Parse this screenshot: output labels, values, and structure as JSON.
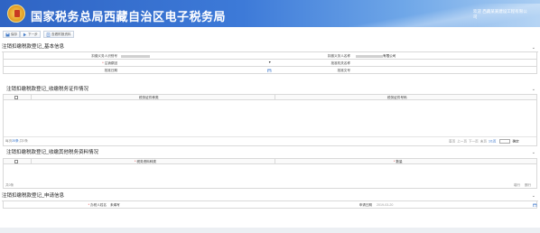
{
  "header": {
    "title": "国家税务总局西藏自治区电子税务局",
    "user_line1": "欢迎 西藏某某建设工程有限公",
    "user_line2": "司"
  },
  "toolbar": {
    "save": "保存",
    "next": "下一步",
    "view_materials": "查看附报资料"
  },
  "basic": {
    "title": "注销扣缴税款登记_基本信息",
    "taxpayer_id_label": "扣缴义务人识别号",
    "taxpayer_name_label": "扣缴义务人名称",
    "taxpayer_name_value": "有限公司",
    "reason_label": "注销原因",
    "org_label": "批准机关名称",
    "date_label": "批准日期",
    "doc_label": "批准文号"
  },
  "certs": {
    "title": "注销扣缴税款登记_收缴税务证件情况",
    "col_type": "税务证件种类",
    "col_no": "税务证件号码",
    "summary_prefix": "每页",
    "summary_count": "20条",
    "summary_suffix": ",共0条",
    "pager_first": "首页",
    "pager_prev": "上一页",
    "pager_next": "下一页",
    "pager_end": "末页",
    "pager_pages": "1/1页",
    "pager_go": "确定"
  },
  "others": {
    "title": "注销扣缴税款登记_收缴其他税务资料情况",
    "col_type": "税务资料种类",
    "col_count": "数量",
    "summary": "共0条",
    "add": "增行",
    "delete": "删行"
  },
  "apply": {
    "title": "注销扣缴税款登记_申请信息",
    "contact_label": "办税人姓名",
    "contact_value": "未填写",
    "date_label": "申请日期",
    "date_value": "2019-03-20"
  }
}
